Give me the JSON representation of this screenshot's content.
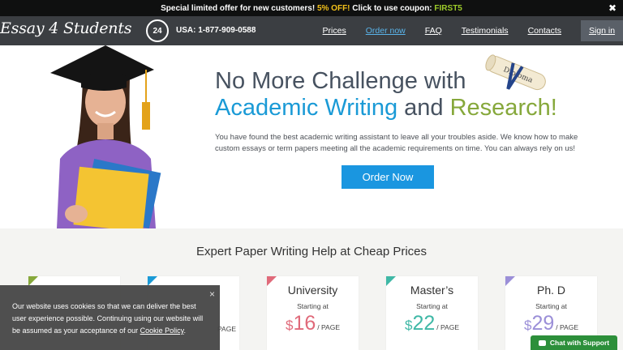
{
  "promo": {
    "text_before": "Special limited offer for new customers!",
    "discount": "5% OFF!",
    "text_middle": "Click to use coupon:",
    "coupon": "FIRST5",
    "close_symbol": "✖"
  },
  "header": {
    "logo": "Essay 4 Students",
    "phone_badge": "24",
    "phone": "USA: 1-877-909-0588",
    "nav": [
      "Prices",
      "Order now",
      "FAQ",
      "Testimonials",
      "Contacts"
    ],
    "signin": "Sign in"
  },
  "hero": {
    "title_line1": "No More Challenge with",
    "title_blue": "Academic Writing",
    "title_and": "and",
    "title_green": "Research!",
    "diploma_text": "Diploma",
    "description": "You have found the best academic writing assistant to leave all your troubles aside. We know how to make custom essays or term papers meeting all the academic requirements on time. You can always rely on us!",
    "order_button": "Order Now"
  },
  "pricing": {
    "title": "Expert Paper Writing Help at Cheap Prices",
    "cards": [
      {
        "name": "",
        "start": "",
        "currency": "",
        "price": "",
        "unit": "",
        "color": "#86a83b"
      },
      {
        "name": "",
        "start": "",
        "currency": "",
        "price": "",
        "unit": "PAGE",
        "color": "#1a9ad6"
      },
      {
        "name": "University",
        "start": "Starting at",
        "currency": "$",
        "price": "16",
        "unit": "/ PAGE",
        "color": "#e06a7a"
      },
      {
        "name": "Master’s",
        "start": "Starting at",
        "currency": "$",
        "price": "22",
        "unit": "/ PAGE",
        "color": "#3fb8a6"
      },
      {
        "name": "Ph. D",
        "start": "Starting at",
        "currency": "$",
        "price": "29",
        "unit": "/ PAGE",
        "color": "#9b8fd8"
      }
    ]
  },
  "cookie": {
    "text": "Our website uses cookies so that we can deliver the best user experience possible. Continuing using our website will be assumed as your acceptance of our",
    "link": "Cookie Policy",
    "end": ".",
    "close": "×"
  },
  "chat": {
    "label": "Chat with Support"
  }
}
